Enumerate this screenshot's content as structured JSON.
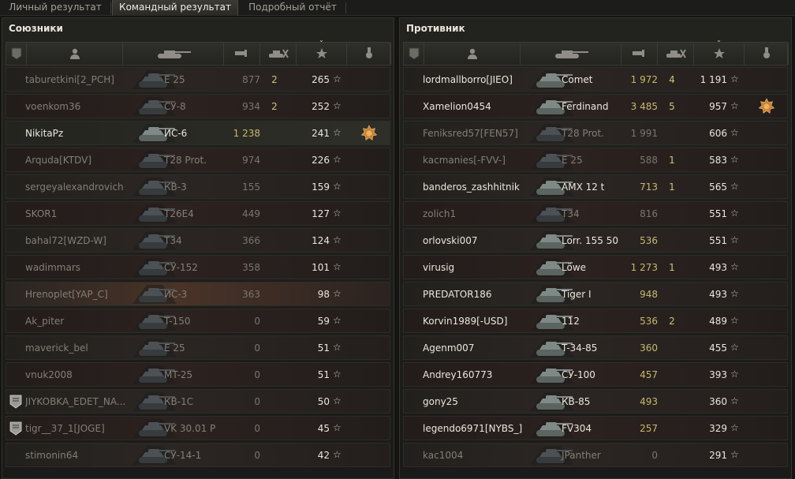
{
  "tabs": [
    {
      "label": "Личный результат",
      "active": false
    },
    {
      "label": "Командный результат",
      "active": true
    },
    {
      "label": "Подробный отчёт",
      "active": false
    }
  ],
  "allies": {
    "title": "Союзники",
    "rows": [
      {
        "name": "taburetkini[2_PCH]",
        "tank": "E 25",
        "damage": "877",
        "kills": "2",
        "xp": "265",
        "alive": false,
        "medal": false,
        "badge": false
      },
      {
        "name": "voenkom36",
        "tank": "СУ-8",
        "damage": "934",
        "kills": "2",
        "xp": "252",
        "alive": false,
        "medal": false,
        "badge": false
      },
      {
        "name": "NikitaPz",
        "tank": "ИС-6",
        "damage": "1 238",
        "kills": "",
        "xp": "241",
        "alive": true,
        "medal": true,
        "badge": false
      },
      {
        "name": "Arquda[KTDV]",
        "tank": "T28 Prot.",
        "damage": "974",
        "kills": "",
        "xp": "226",
        "alive": false,
        "medal": false,
        "badge": false
      },
      {
        "name": "sergeyalexandrovich",
        "tank": "КВ-3",
        "damage": "155",
        "kills": "",
        "xp": "159",
        "alive": false,
        "medal": false,
        "badge": false
      },
      {
        "name": "SKOR1",
        "tank": "T26E4",
        "damage": "449",
        "kills": "",
        "xp": "127",
        "alive": false,
        "medal": false,
        "badge": false
      },
      {
        "name": "bahal72[WZD-W]",
        "tank": "T34",
        "damage": "366",
        "kills": "",
        "xp": "124",
        "alive": false,
        "medal": false,
        "badge": false
      },
      {
        "name": "wadimmars",
        "tank": "СУ-152",
        "damage": "358",
        "kills": "",
        "xp": "101",
        "alive": false,
        "medal": false,
        "badge": false
      },
      {
        "name": "Hrenoplet[YAP_C]",
        "tank": "ИС-3",
        "damage": "363",
        "kills": "",
        "xp": "98",
        "alive": false,
        "medal": false,
        "badge": false
      },
      {
        "name": "Ak_piter",
        "tank": "T-150",
        "damage": "0",
        "kills": "",
        "xp": "59",
        "alive": false,
        "medal": false,
        "badge": false
      },
      {
        "name": "maverick_bel",
        "tank": "E 25",
        "damage": "0",
        "kills": "",
        "xp": "51",
        "alive": false,
        "medal": false,
        "badge": false
      },
      {
        "name": "vnuk2008",
        "tank": "MT-25",
        "damage": "0",
        "kills": "",
        "xp": "51",
        "alive": false,
        "medal": false,
        "badge": false
      },
      {
        "name": "JIYKOBKA_EDET_NA...",
        "tank": "КВ-1С",
        "damage": "0",
        "kills": "",
        "xp": "50",
        "alive": false,
        "medal": false,
        "badge": true
      },
      {
        "name": "tigr__37_1[JOGE]",
        "tank": "VK 30.01 P",
        "damage": "0",
        "kills": "",
        "xp": "45",
        "alive": false,
        "medal": false,
        "badge": true
      },
      {
        "name": "stimonin64",
        "tank": "СУ-14-1",
        "damage": "0",
        "kills": "",
        "xp": "42",
        "alive": false,
        "medal": false,
        "badge": false
      }
    ]
  },
  "enemies": {
    "title": "Противник",
    "rows": [
      {
        "name": "lordmallborro[JIEO]",
        "tank": "Comet",
        "damage": "1 972",
        "kills": "4",
        "xp": "1 191",
        "alive": true,
        "medal": false,
        "badge": false
      },
      {
        "name": "Xamelion0454",
        "tank": "Ferdinand",
        "damage": "3 485",
        "kills": "5",
        "xp": "957",
        "alive": true,
        "medal": true,
        "badge": false
      },
      {
        "name": "Feniksred57[FEN57]",
        "tank": "T28 Prot.",
        "damage": "1 991",
        "kills": "",
        "xp": "606",
        "alive": false,
        "medal": false,
        "badge": false
      },
      {
        "name": "kacmanies[-FVV-]",
        "tank": "E 25",
        "damage": "588",
        "kills": "1",
        "xp": "583",
        "alive": false,
        "medal": false,
        "badge": false
      },
      {
        "name": "banderos_zashhitnik",
        "tank": "AMX 12 t",
        "damage": "713",
        "kills": "1",
        "xp": "565",
        "alive": true,
        "medal": false,
        "badge": false
      },
      {
        "name": "zolich1",
        "tank": "T34",
        "damage": "816",
        "kills": "",
        "xp": "551",
        "alive": false,
        "medal": false,
        "badge": false
      },
      {
        "name": "orlovski007",
        "tank": "Lorr. 155 50",
        "damage": "536",
        "kills": "",
        "xp": "551",
        "alive": true,
        "medal": false,
        "badge": false
      },
      {
        "name": "virusig",
        "tank": "Löwe",
        "damage": "1 273",
        "kills": "1",
        "xp": "493",
        "alive": true,
        "medal": false,
        "badge": false
      },
      {
        "name": "PREDATOR186",
        "tank": "Tiger I",
        "damage": "948",
        "kills": "",
        "xp": "493",
        "alive": true,
        "medal": false,
        "badge": false
      },
      {
        "name": "Korvin1989[-USD]",
        "tank": "112",
        "damage": "536",
        "kills": "2",
        "xp": "489",
        "alive": true,
        "medal": false,
        "badge": false
      },
      {
        "name": "Agenm007",
        "tank": "T-34-85",
        "damage": "360",
        "kills": "",
        "xp": "455",
        "alive": true,
        "medal": false,
        "badge": false
      },
      {
        "name": "Andrey160773",
        "tank": "СУ-100",
        "damage": "457",
        "kills": "",
        "xp": "393",
        "alive": true,
        "medal": false,
        "badge": false
      },
      {
        "name": "gony25",
        "tank": "КВ-85",
        "damage": "493",
        "kills": "",
        "xp": "360",
        "alive": true,
        "medal": false,
        "badge": false
      },
      {
        "name": "legendo6971[NYBS_]",
        "tank": "FV304",
        "damage": "257",
        "kills": "",
        "xp": "329",
        "alive": true,
        "medal": false,
        "badge": false
      },
      {
        "name": "kac1004",
        "tank": "JPanther",
        "damage": "0",
        "kills": "",
        "xp": "291",
        "alive": false,
        "medal": false,
        "badge": false
      }
    ]
  },
  "colors": {
    "accent": "#c9b86b",
    "alive_text": "#eae7dc",
    "dead_text": "#837f75"
  },
  "icons": {
    "header": [
      "badge-icon",
      "player-icon",
      "tank-icon",
      "damage-icon",
      "kills-icon",
      "xp-star-icon",
      "medal-icon"
    ]
  }
}
